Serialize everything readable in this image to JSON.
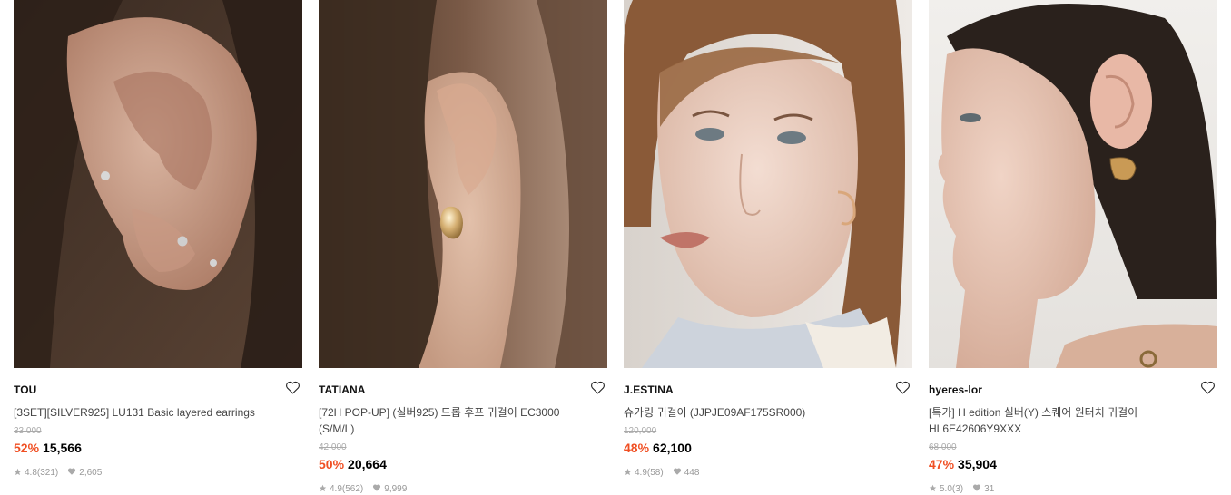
{
  "colors": {
    "discount": "#f04f23",
    "original_price": "#aaaaaa",
    "meta": "#999999"
  },
  "products": [
    {
      "brand": "TOU",
      "title": "[3SET][SILVER925] LU131 Basic layered earrings",
      "original_price": "33,000",
      "discount": "52%",
      "price": "15,566",
      "rating": "4.8",
      "reviews": "(321)",
      "likes": "2,605",
      "image_icon": "ear-piercing-photo"
    },
    {
      "brand": "TATIANA",
      "title": "[72H POP-UP] (실버925) 드롭 후프 귀걸이 EC3000 (S/M/L)",
      "original_price": "42,000",
      "discount": "50%",
      "price": "20,664",
      "rating": "4.9",
      "reviews": "(562)",
      "likes": "9,999",
      "image_icon": "drop-hoop-photo"
    },
    {
      "brand": "J.ESTINA",
      "title": "슈가링 귀걸이 (JJPJE09AF175SR000)",
      "original_price": "120,000",
      "discount": "48%",
      "price": "62,100",
      "rating": "4.9",
      "reviews": "(58)",
      "likes": "448",
      "image_icon": "model-portrait-photo"
    },
    {
      "brand": "hyeres-lor",
      "title": "[특가] H edition 실버(Y) 스퀘어 원터치 귀걸이 HL6E42606Y9XXX",
      "original_price": "68,000",
      "discount": "47%",
      "price": "35,904",
      "rating": "5.0",
      "reviews": "(3)",
      "likes": "31",
      "image_icon": "model-profile-photo"
    }
  ]
}
